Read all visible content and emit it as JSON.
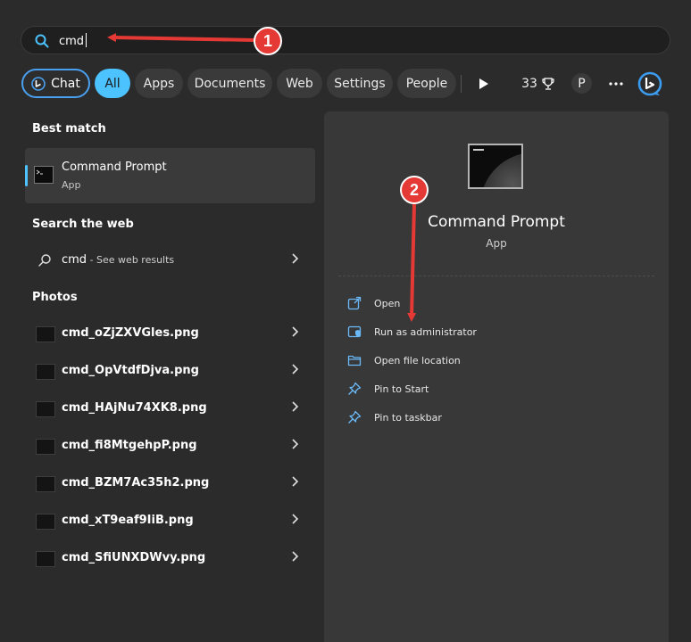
{
  "search": {
    "value": "cmd"
  },
  "filters": {
    "chat_label": "Chat",
    "all_label": "All",
    "apps_label": "Apps",
    "documents_label": "Documents",
    "web_label": "Web",
    "settings_label": "Settings",
    "people_label": "People",
    "points": "33",
    "profile_initial": "P"
  },
  "best_match": {
    "heading": "Best match",
    "name": "Command Prompt",
    "type": "App"
  },
  "web": {
    "heading": "Search the web",
    "query": "cmd",
    "suffix": " - See web results"
  },
  "photos": {
    "heading": "Photos",
    "items": [
      "cmd_oZjZXVGles.png",
      "cmd_OpVtdfDjva.png",
      "cmd_HAjNu74XK8.png",
      "cmd_fi8MtgehpP.png",
      "cmd_BZM7Ac35h2.png",
      "cmd_xT9eaf9IiB.png",
      "cmd_SfiUNXDWvy.png"
    ]
  },
  "details": {
    "title": "Command Prompt",
    "type": "App",
    "actions": {
      "open": "Open",
      "run_admin": "Run as administrator",
      "open_location": "Open file location",
      "pin_start": "Pin to Start",
      "pin_taskbar": "Pin to taskbar"
    }
  },
  "annotations": {
    "step1": "1",
    "step2": "2"
  },
  "colors": {
    "accent": "#4cc2ff",
    "annotation": "#e53935",
    "panel": "#383838",
    "background": "#2b2b2b"
  }
}
